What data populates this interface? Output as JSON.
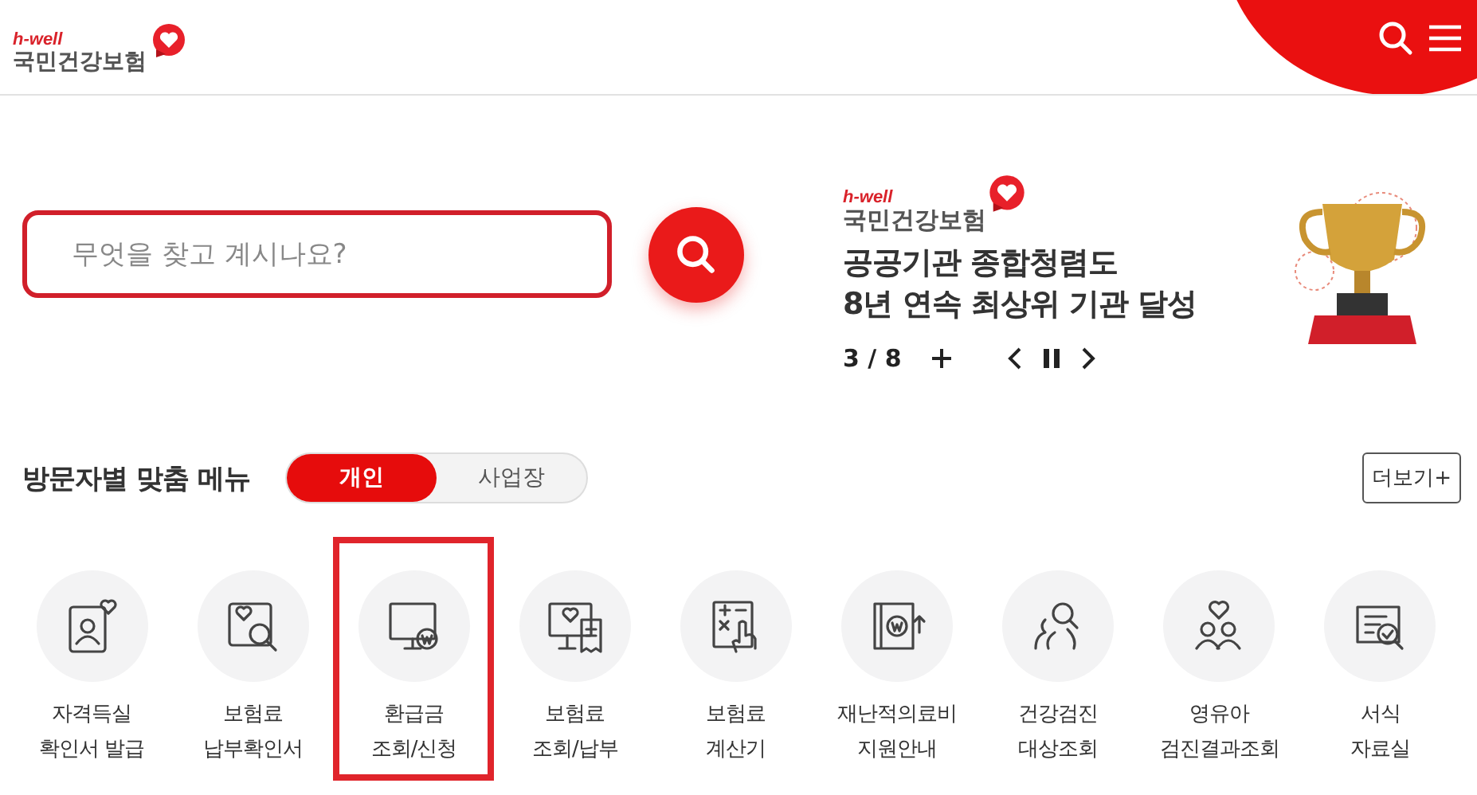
{
  "header": {
    "logo_tagline": "h-well",
    "logo_name": "국민건강보험"
  },
  "search": {
    "placeholder": "무엇을 찾고 계시나요?"
  },
  "banner": {
    "logo_tagline": "h-well",
    "logo_name": "국민건강보험",
    "title_lines": [
      "공공기관 종합청렴도",
      "8년 연속 최상위 기관 달성"
    ],
    "page_current": "3",
    "page_separator": "/",
    "page_total": "8",
    "paused": false
  },
  "menu": {
    "title": "방문자별 맞춤 메뉴",
    "tabs": [
      {
        "label": "개인",
        "selected": true
      },
      {
        "label": "사업장",
        "selected": false
      }
    ],
    "more_button": "더보기+",
    "items": [
      {
        "lines": [
          "자격득실",
          "확인서 발급"
        ],
        "highlighted": false
      },
      {
        "lines": [
          "보험료",
          "납부확인서"
        ],
        "highlighted": false
      },
      {
        "lines": [
          "환급금",
          "조회/신청"
        ],
        "highlighted": true
      },
      {
        "lines": [
          "보험료",
          "조회/납부"
        ],
        "highlighted": false
      },
      {
        "lines": [
          "보험료",
          "계산기"
        ],
        "highlighted": false
      },
      {
        "lines": [
          "재난적의료비",
          "지원안내"
        ],
        "highlighted": false
      },
      {
        "lines": [
          "건강검진",
          "대상조회"
        ],
        "highlighted": false
      },
      {
        "lines": [
          "영유아",
          "검진결과조회"
        ],
        "highlighted": false
      },
      {
        "lines": [
          "서식",
          "자료실"
        ],
        "highlighted": false
      }
    ]
  }
}
